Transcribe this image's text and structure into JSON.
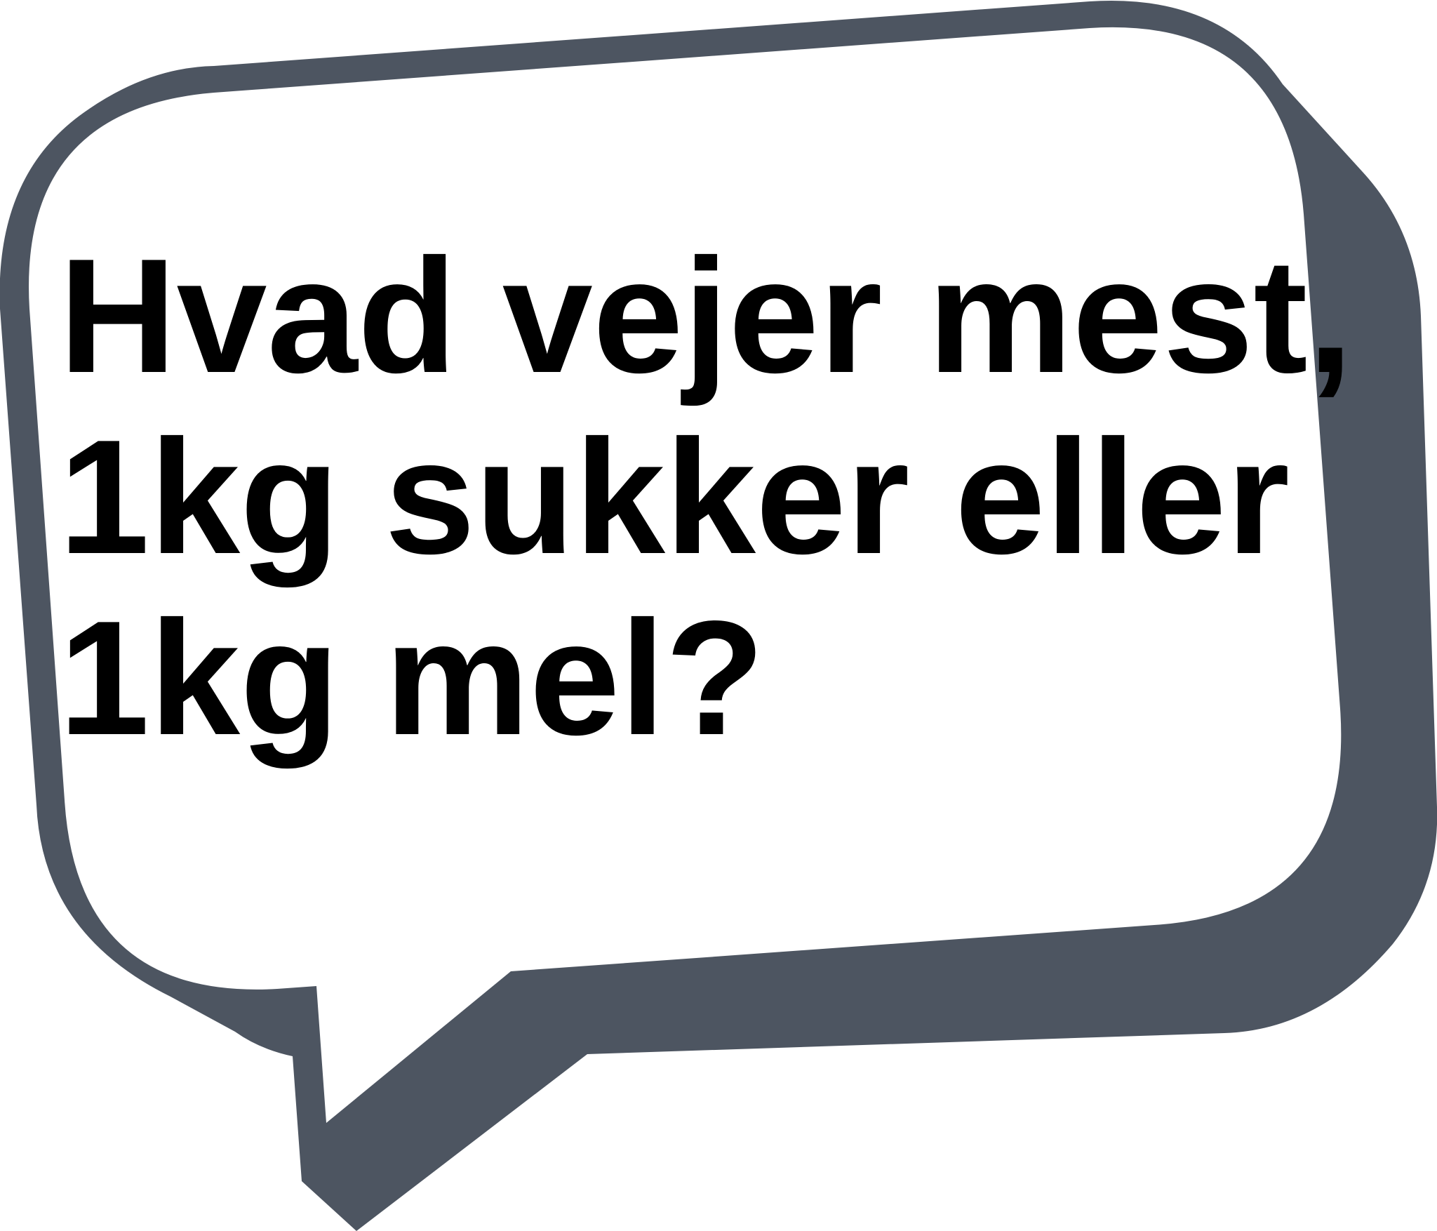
{
  "colors": {
    "bubble_fill": "#ffffff",
    "bubble_outline": "#4d5561",
    "text": "#000000"
  },
  "bubble": {
    "kind": "speech-bubble",
    "tail": "bottom-left"
  },
  "question": {
    "lines": [
      "Hvad vejer mest,",
      "1kg sukker eller",
      "1kg mel?"
    ]
  }
}
